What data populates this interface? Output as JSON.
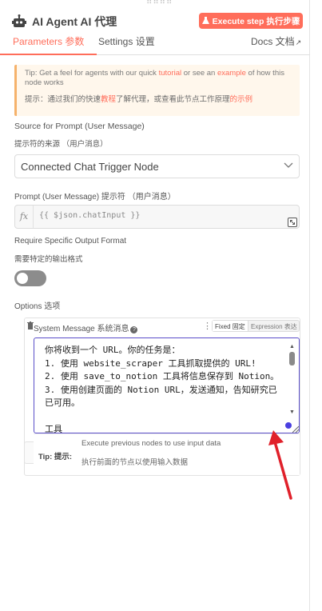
{
  "header": {
    "title": "AI Agent  AI 代理",
    "execute_label": "Execute step  执行步骤"
  },
  "tabs": {
    "parameters": "Parameters  参数",
    "settings": "Settings  设置",
    "docs": "Docs  文档"
  },
  "tip_box": {
    "en_prefix": "Tip: Get a feel for agents with our quick ",
    "en_link1": "tutorial",
    "en_mid": " or see an ",
    "en_link2": "example",
    "en_suffix": " of how this node works",
    "cn_prefix": "提示：通过我们的快速",
    "cn_link1": "教程",
    "cn_mid": "了解代理，或查看此节点工作原理",
    "cn_link2": "的示例"
  },
  "source_prompt": {
    "label_en": "Source for Prompt (User Message)",
    "label_cn": "提示符的来源 （用户消息）",
    "selected": "Connected Chat Trigger Node"
  },
  "prompt": {
    "label": "Prompt (User Message)  提示符 （用户消息）",
    "fx": "fx",
    "value": "{{ $json.chatInput }}"
  },
  "output_format": {
    "label_en": "Require Specific Output Format",
    "label_cn": "需要特定的输出格式",
    "enabled": false
  },
  "options": {
    "label": "Options  选项",
    "system_message_label": "System Message  系统消息",
    "mode_fixed": "Fixed 固定",
    "mode_expression": "Expression 表达",
    "system_message_text": "你将收到一个 URL。你的任务是：\n1. 使用 website_scraper 工具抓取提供的 URL!\n2. 使用 save_to_notion 工具将信息保存到 Notion。\n3. 使用创建页面的 Notion URL，发送通知，告知研究已已可用。\n\n工具"
  },
  "input_tip": {
    "tag": "Tip:  提示:",
    "line1": "Execute previous nodes to use input data",
    "line2": "执行前面的节点以使用输入数据"
  },
  "colors": {
    "accent": "#ff6d5a",
    "focus": "#5b4fc9",
    "annotation_arrow": "#e0202a"
  }
}
